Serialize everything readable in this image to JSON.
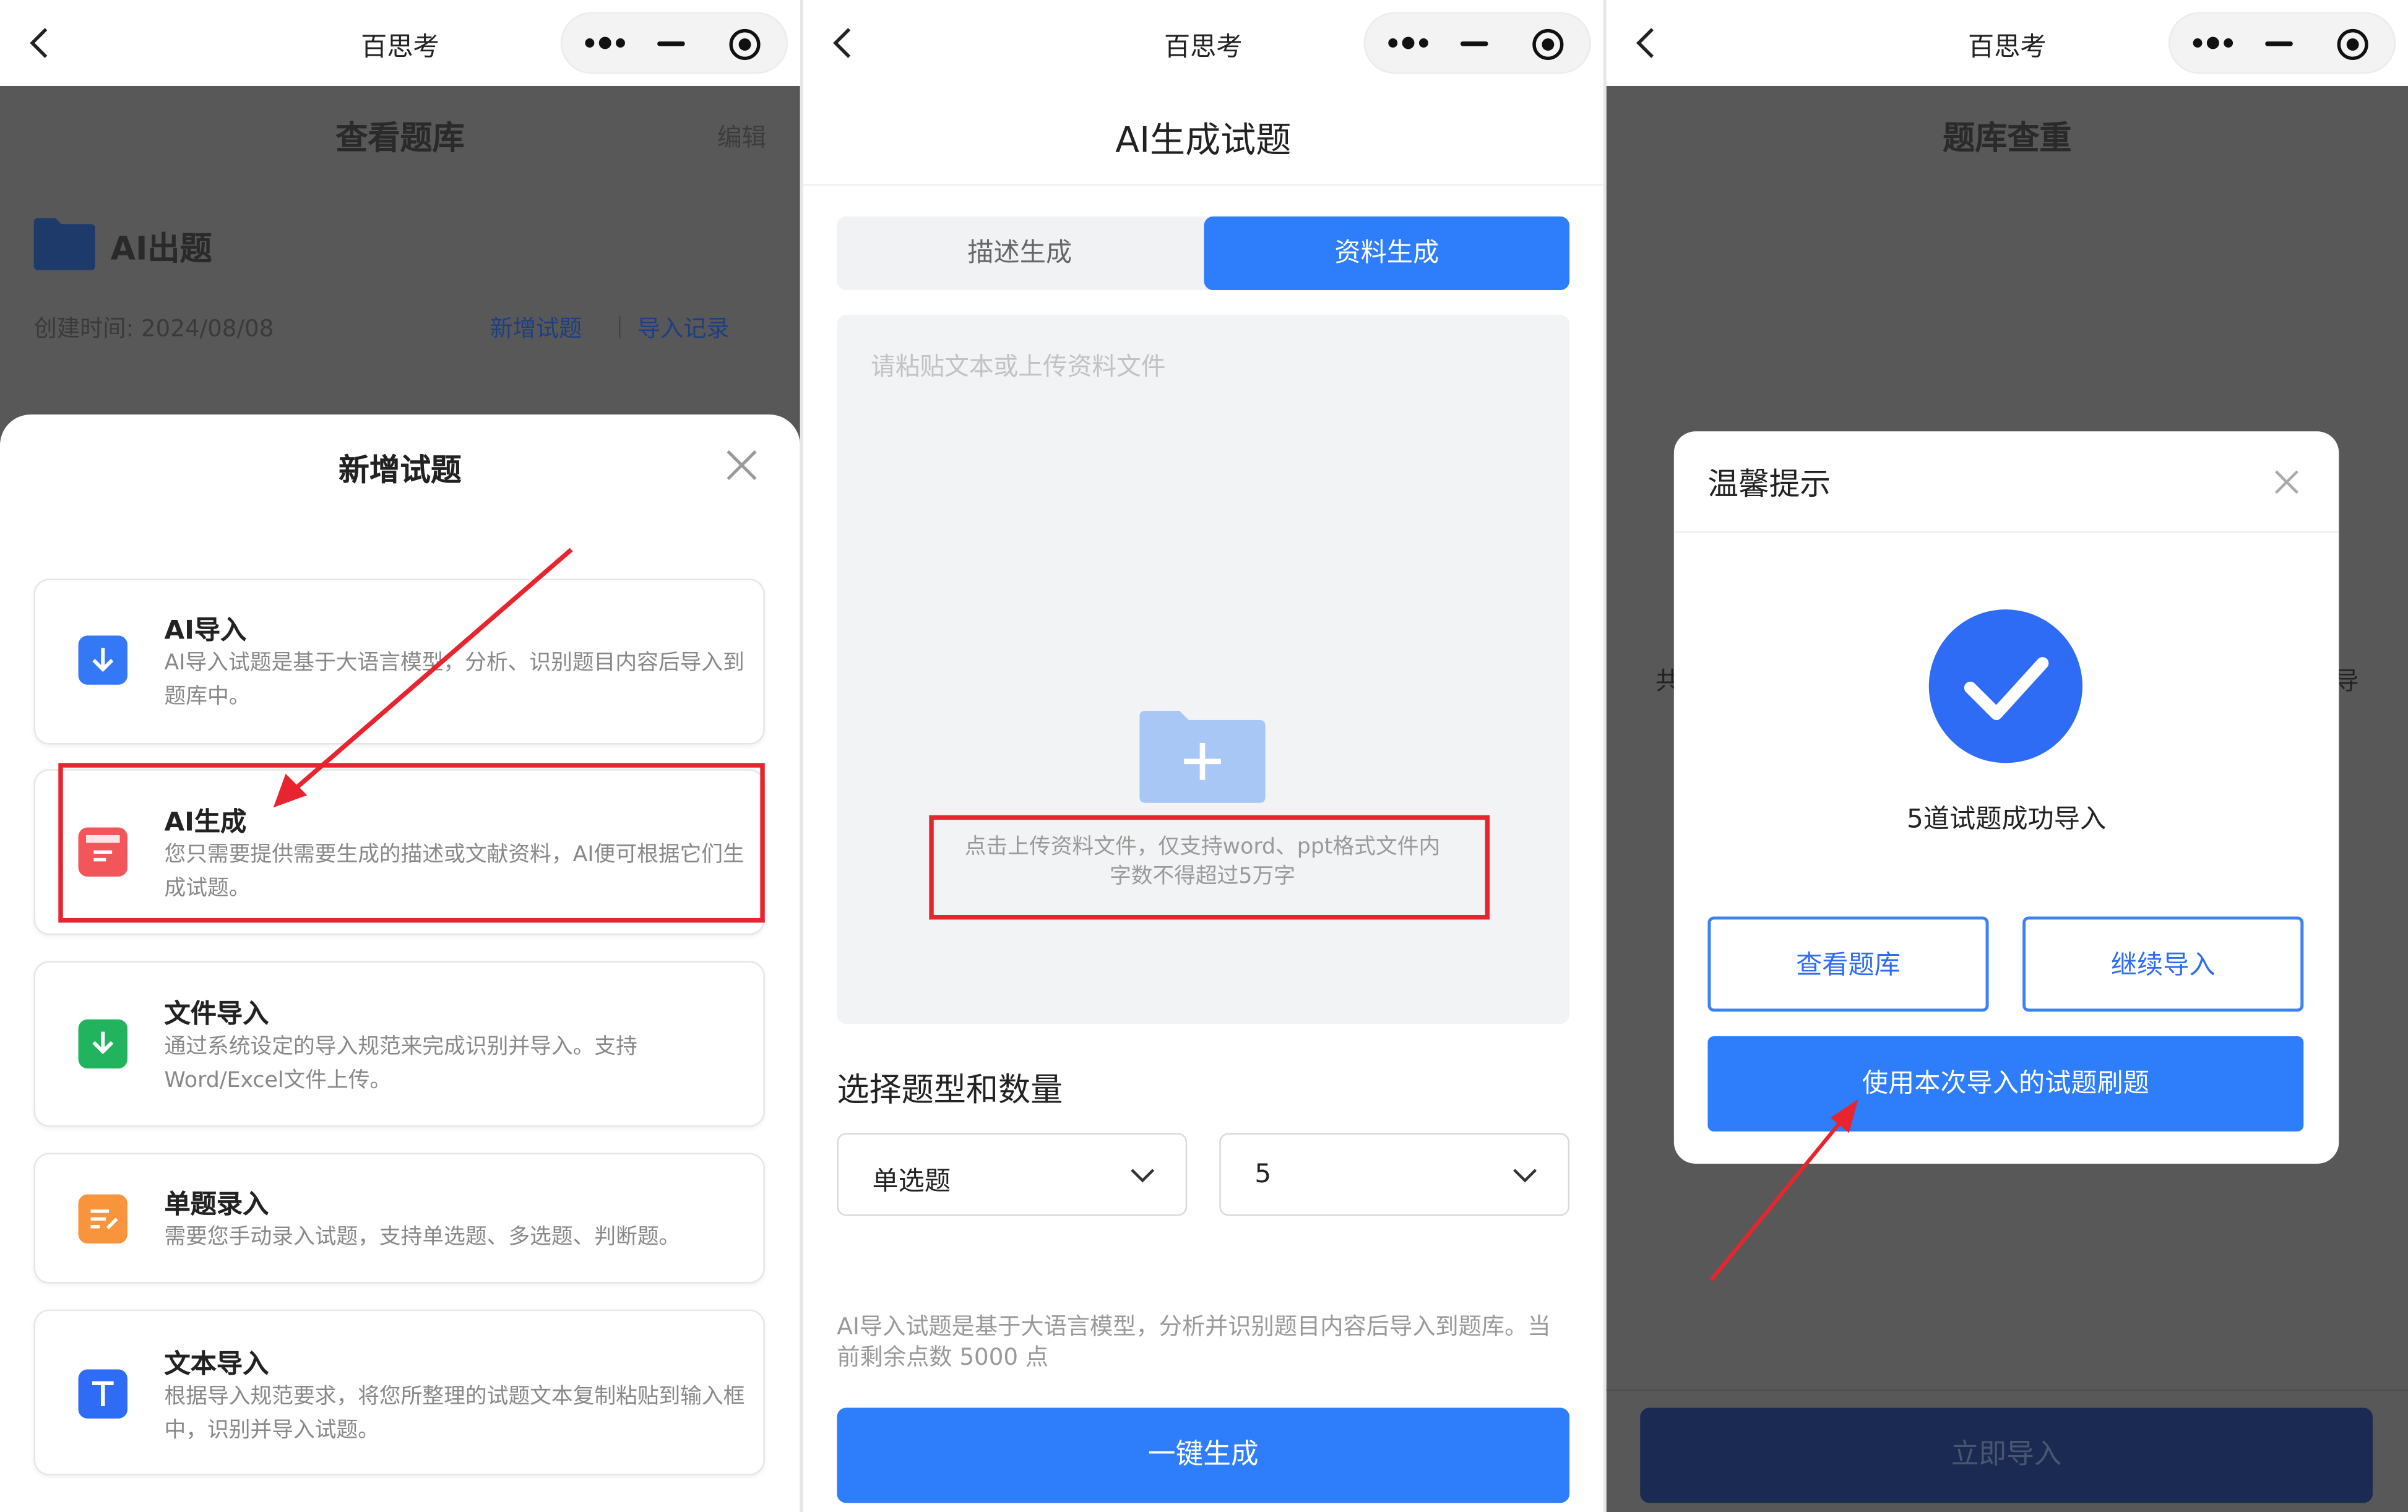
{
  "app_title": "百思考",
  "screen1": {
    "page_title": "查看题库",
    "edit_label": "编辑",
    "folder_name": "AI出题",
    "created_label": "创建时间: 2024/08/08",
    "add_question_link": "新增试题",
    "import_record_link": "导入记录",
    "sheet_title": "新增试题",
    "options": [
      {
        "title": "AI导入",
        "desc": "AI导入试题是基于大语言模型，分析、识别题目内容后导入到题库中。",
        "icon": "arrow-down-icon",
        "color": "#3478f6"
      },
      {
        "title": "AI生成",
        "desc": "您只需要提供需要生成的描述或文献资料，AI便可根据它们生成试题。",
        "icon": "document-icon",
        "color": "#f2555a"
      },
      {
        "title": "文件导入",
        "desc": "通过系统设定的导入规范来完成识别并导入。支持Word/Excel文件上传。",
        "icon": "folder-download-icon",
        "color": "#22b35e"
      },
      {
        "title": "单题录入",
        "desc": "需要您手动录入试题，支持单选题、多选题、判断题。",
        "icon": "edit-list-icon",
        "color": "#f7943c"
      },
      {
        "title": "文本导入",
        "desc": "根据导入规范要求，将您所整理的试题文本复制粘贴到输入框中，识别并导入试题。",
        "icon": "text-t-icon",
        "color": "#2e6cf5"
      }
    ]
  },
  "screen2": {
    "page_title": "AI生成试题",
    "tabs": [
      "描述生成",
      "资料生成"
    ],
    "active_tab": 1,
    "textarea_placeholder": "请粘贴文本或上传资料文件",
    "upload_hint": "点击上传资料文件，仅支持word、ppt格式文件内字数不得超过5万字",
    "section_title": "选择题型和数量",
    "type_select": "单选题",
    "count_select": "5",
    "note": "AI导入试题是基于大语言模型，分析并识别题目内容后导入到题库。当前剩余点数 5000 点",
    "generate_button": "一键生成"
  },
  "screen3": {
    "page_title": "题库查重",
    "bg_left_char": "共",
    "bg_right_char": "导",
    "dialog_title": "温馨提示",
    "success_message": "5道试题成功导入",
    "view_bank_button": "查看题库",
    "continue_import_button": "继续导入",
    "practice_button": "使用本次导入的试题刷题",
    "import_now_button": "立即导入"
  }
}
